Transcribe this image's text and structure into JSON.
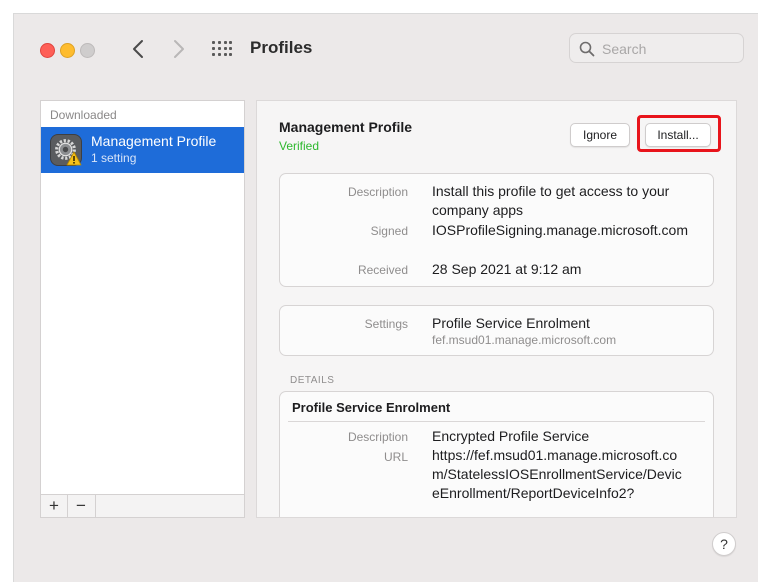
{
  "window": {
    "title": "Profiles",
    "search_placeholder": "Search",
    "nav_back": "‹",
    "nav_forward": "›"
  },
  "sidebar": {
    "header": "Downloaded",
    "items": [
      {
        "title": "Management Profile",
        "subtitle": "1 setting",
        "icon": "settings-gear-warning-icon",
        "selected": true
      }
    ],
    "add_label": "+",
    "remove_label": "−"
  },
  "profile": {
    "title": "Management Profile",
    "status": "Verified",
    "status_color": "#2eb82e",
    "ignore_label": "Ignore",
    "install_label": "Install...",
    "highlight_color": "#e8141b",
    "summary": {
      "description_label": "Description",
      "description_value": "Install this profile to get access to your company apps",
      "signed_label": "Signed",
      "signed_value": "IOSProfileSigning.manage.microsoft.com",
      "received_label": "Received",
      "received_value": "28 Sep 2021 at 9:12 am"
    },
    "settings": {
      "label": "Settings",
      "value": "Profile Service Enrolment",
      "subvalue": "fef.msud01.manage.microsoft.com"
    },
    "details": {
      "header": "DETAILS",
      "section_title": "Profile Service Enrolment",
      "description_label": "Description",
      "description_value": "Encrypted Profile Service",
      "url_label": "URL",
      "url_value": "https://fef.msud01.manage.microsoft.com/StatelessIOSEnrollmentService/DeviceEnrollment/ReportDeviceInfo2?"
    }
  },
  "help_label": "?",
  "accent_color": "#1e6cd9"
}
